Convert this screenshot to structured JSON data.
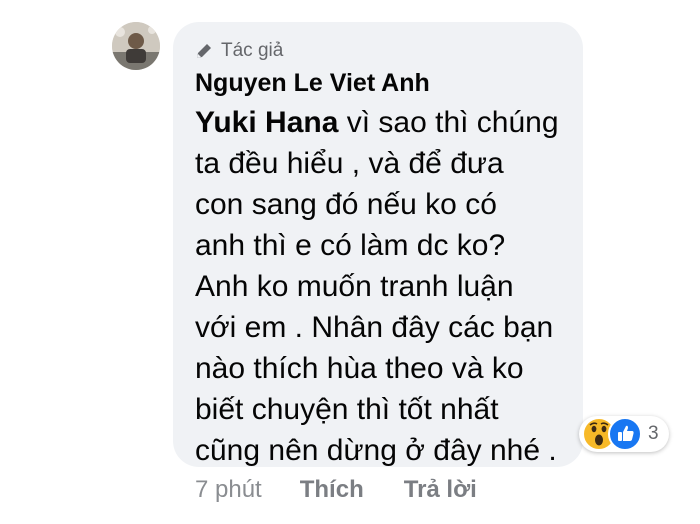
{
  "comment": {
    "badge_label": "Tác giả",
    "author_name": "Nguyen Le Viet Anh",
    "mention": "Yuki Hana",
    "lines": [
      " vì sao thì chúng",
      "ta đều hiểu , và để đưa",
      "con sang đó nếu ko có",
      "anh thì e có làm dc ko?",
      "Anh ko muốn tranh luận",
      "với em . Nhân đây các bạn",
      "nào thích hùa theo và ko",
      "biết chuyện thì tốt nhất",
      "cũng nên dừng ở đây nhé ."
    ],
    "reactions": {
      "icons": [
        "wow-icon",
        "like-icon"
      ],
      "count": "3"
    }
  },
  "actions": {
    "timestamp": "7 phút",
    "like_label": "Thích",
    "reply_label": "Trả lời"
  },
  "colors": {
    "bubble": "#f0f2f5",
    "like_blue": "#1877f2",
    "wow_yellow": "#f7b928"
  }
}
